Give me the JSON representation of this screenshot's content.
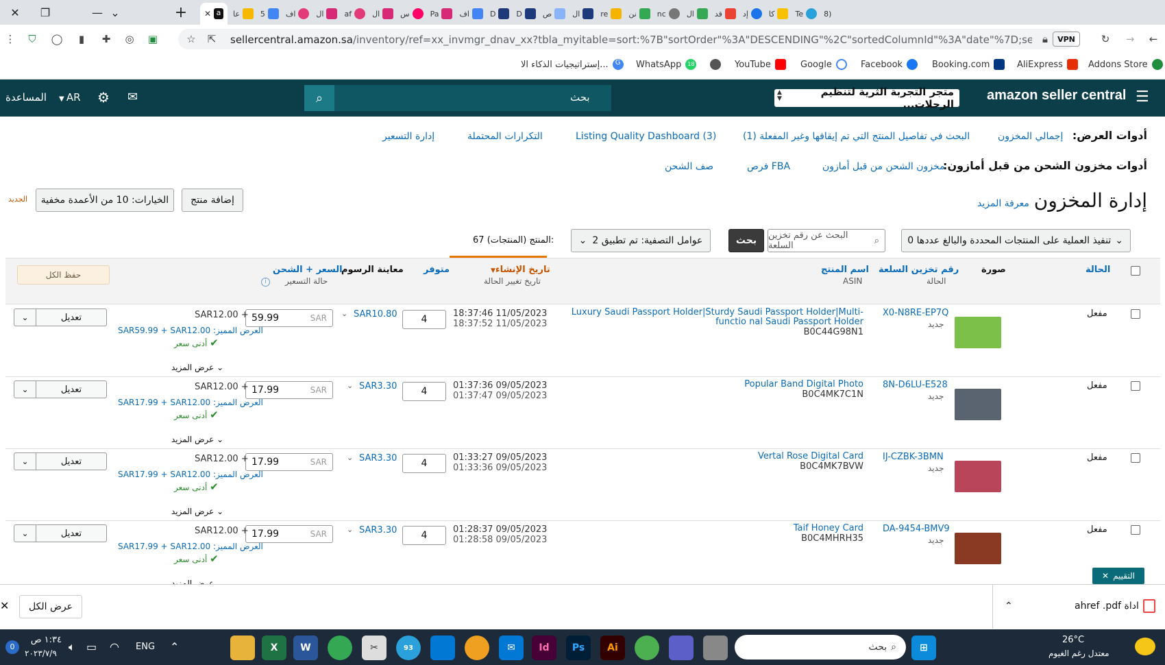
{
  "browser": {
    "tabs": [
      "عا",
      "5",
      "اف",
      "ال",
      "af",
      "ال",
      "س",
      "Pa",
      "اف",
      "D",
      "D",
      "ص",
      "ال",
      "re",
      "نن",
      "nc",
      "ال",
      "قد",
      "إد",
      "كا",
      "Te",
      "8)"
    ],
    "new_tab": "+",
    "url_host": "sellercentral.amazon.sa",
    "url_path": "/inventory/ref=xx_invmgr_dnav_xx?tbla_myitable=sort:%7B\"sortOrder\"%3A\"DESCENDING\"%2C\"sortedColumnId\"%3A\"date\"%7D;search:;paginati...",
    "vpn_badge": "VPN",
    "bookmarks": [
      "Addons Store",
      "AliExpress",
      "Booking.com",
      "Facebook",
      "Google",
      "YouTube",
      "WhatsApp",
      "إستراتيجيات الذكاء الا..."
    ],
    "whatsapp_badge": "18"
  },
  "header": {
    "logo": "amazon seller central",
    "store_name": "متجر التجربة الثرية لتنظيم الرحلات...",
    "search_placeholder": "بحث",
    "language": "AR",
    "help": "المساعدة"
  },
  "tools": {
    "view_label": "أدوات العرض:",
    "view_links": [
      "إجمالي المخزون",
      "البحث في تفاصيل المنتج التي تم إيقافها وغير المفعلة (1)",
      "Listing Quality Dashboard (3)",
      "التكرارات المحتملة",
      "إدارة التسعير"
    ],
    "fba_label": "أدوات مخزون الشحن من قبل أمازون:",
    "fba_links": [
      "مخزون الشحن من قبل أمازون",
      "فرص FBA",
      "صف الشحن"
    ]
  },
  "page": {
    "title": "إدارة المخزون",
    "learn_more": "معرفة المزيد",
    "new_badge": "الجديد",
    "options_button": "الخيارات: 10 من الأعمدة مخفية",
    "add_product_button": "إضافة منتج",
    "bulk_action": "تنفيذ العملية على المنتجات المحددة والبالغ عددها 0",
    "search_placeholder": "البحث عن رقم تخزين السلعة",
    "search_button": "بحث",
    "filters": "عوامل التصفية: تم تطبيق 2",
    "count": "67 المنتج (المنتجات):",
    "save_all": "حفظ الكل"
  },
  "columns": {
    "status": "الحالة",
    "image": "صورة",
    "sku": "رقم تخزين السلعة",
    "sku_sub": "الحالة",
    "name": "اسم المنتج",
    "name_sub": "ASIN",
    "created": "تاريخ الإنشاء",
    "created_sub": "تاريخ تغيير الحالة",
    "available": "متوفر",
    "fee_preview": "معاينة الرسوم",
    "price": "السعر + الشحن",
    "price_sub": "حالة التسعير"
  },
  "rows": [
    {
      "status": "مفعل",
      "sku": "X0-N8RE-EP7Q",
      "condition": "جديد",
      "name": "Luxury Saudi Passport Holder|Sturdy Saudi Passport Holder|Multi-functio nal Saudi Passport Holder",
      "asin": "B0C44G98N1",
      "created": "18:37:46 11/05/2023",
      "changed": "18:37:52 11/05/2023",
      "qty": "4",
      "fee": "SAR10.80",
      "price": "59.99",
      "currency": "SAR",
      "shipping": "SAR12.00 +",
      "featured": "العرض المميز: SAR59.99 + SAR12.00",
      "lowest": "أدنى سعر",
      "more": "عرض المزيد",
      "edit": "تعديل",
      "thumb_color": "#7cc04a"
    },
    {
      "status": "مفعل",
      "sku": "8N-D6LU-E528",
      "condition": "جديد",
      "name": "Popular Band Digital Photo",
      "asin": "B0C4MK7C1N",
      "created": "01:37:36 09/05/2023",
      "changed": "01:37:47 09/05/2023",
      "qty": "4",
      "fee": "SAR3.30",
      "price": "17.99",
      "currency": "SAR",
      "shipping": "SAR12.00 +",
      "featured": "العرض المميز: SAR17.99 + SAR12.00",
      "lowest": "أدنى سعر",
      "more": "عرض المزيد",
      "edit": "تعديل",
      "thumb_color": "#5a6470"
    },
    {
      "status": "مفعل",
      "sku": "IJ-CZBK-3BMN",
      "condition": "جديد",
      "name": "Vertal Rose Digital Card",
      "asin": "B0C4MK7BVW",
      "created": "01:33:27 09/05/2023",
      "changed": "01:33:36 09/05/2023",
      "qty": "4",
      "fee": "SAR3.30",
      "price": "17.99",
      "currency": "SAR",
      "shipping": "SAR12.00 +",
      "featured": "العرض المميز: SAR17.99 + SAR12.00",
      "lowest": "أدنى سعر",
      "more": "عرض المزيد",
      "edit": "تعديل",
      "thumb_color": "#b8455a"
    },
    {
      "status": "مفعل",
      "sku": "DA-9454-BMV9",
      "condition": "جديد",
      "name": "Taif Honey Card",
      "asin": "B0C4MHRH35",
      "created": "01:28:37 09/05/2023",
      "changed": "01:28:58 09/05/2023",
      "qty": "4",
      "fee": "SAR3.30",
      "price": "17.99",
      "currency": "SAR",
      "shipping": "SAR12.00 +",
      "featured": "العرض المميز: SAR17.99 + SAR12.00",
      "lowest": "أدنى سعر",
      "more": "عرض المزيد",
      "edit": "تعديل",
      "thumb_color": "#8a3a22"
    }
  ],
  "rating_tab": "التقييم",
  "download": {
    "file": "ahref .pdf اداة",
    "show_all": "عرض الكل"
  },
  "taskbar": {
    "weather_temp": "26°C",
    "weather_desc": "معتدل رغم الغيوم",
    "search_placeholder": "بحث",
    "lang": "ENG",
    "time": "١:٣٤ ص",
    "date": "٢٠٢٣/٧/٩",
    "notif": "0",
    "chrome_badge": "93"
  }
}
